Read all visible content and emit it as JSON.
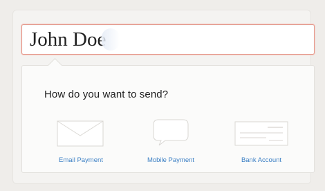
{
  "form": {
    "recipient_name": "John Doe"
  },
  "send_panel": {
    "prompt": "How do you want to send?",
    "options": [
      {
        "label": "Email Payment",
        "icon": "envelope-icon"
      },
      {
        "label": "Mobile Payment",
        "icon": "speech-bubble-icon"
      },
      {
        "label": "Bank Account",
        "icon": "check-icon"
      }
    ]
  },
  "colors": {
    "accent_link": "#3b7fc4",
    "input_focus_border": "#e59a8e"
  }
}
